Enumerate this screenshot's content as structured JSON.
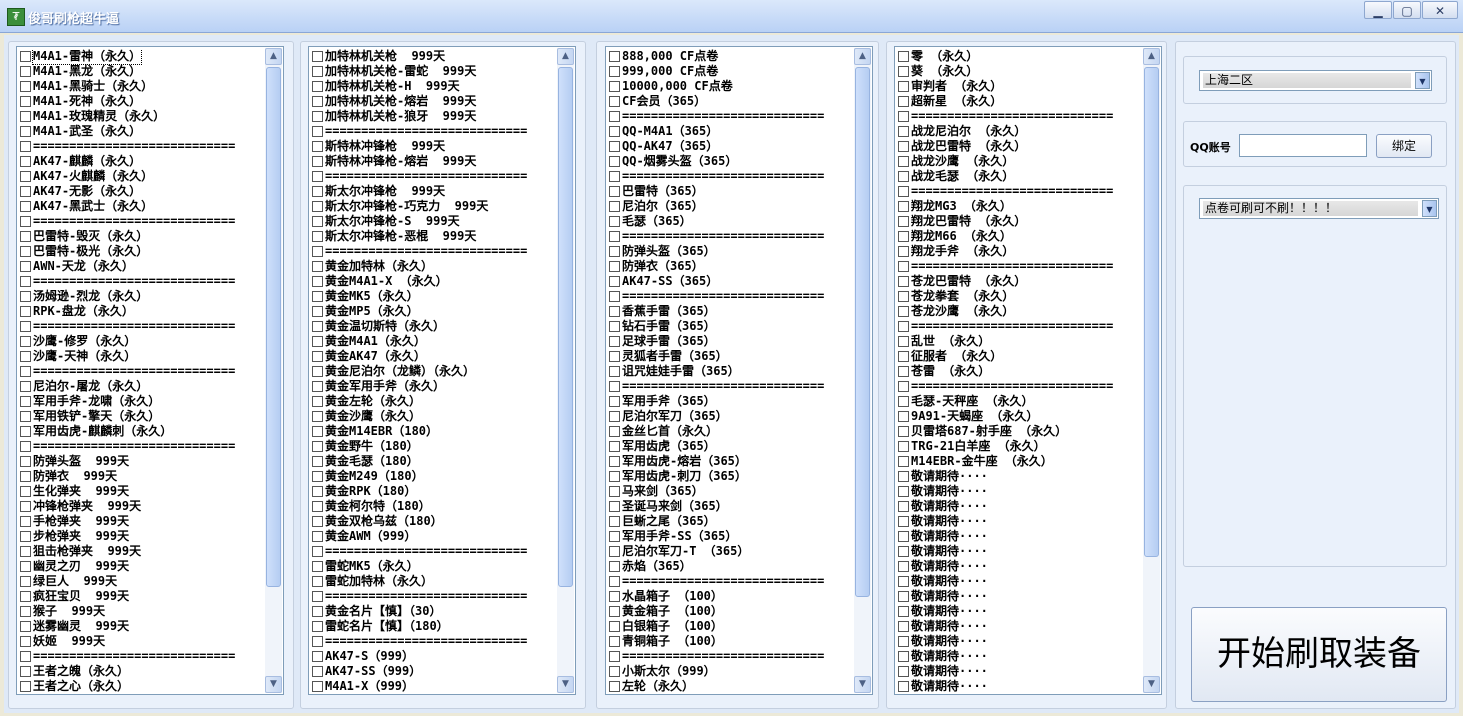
{
  "window": {
    "title": "俊哥刷枪超牛逼",
    "icon": "app-logo-icon",
    "controls": [
      "minimize-icon",
      "maximize-icon",
      "close-icon"
    ]
  },
  "lists": [
    [
      "M4A1-雷神（永久）",
      "M4A1-黑龙（永久）",
      "M4A1-黑骑士（永久）",
      "M4A1-死神（永久）",
      "M4A1-玫瑰精灵（永久）",
      "M4A1-武圣（永久）",
      "============================",
      "AK47-麒麟（永久）",
      "AK47-火麒麟（永久）",
      "AK47-无影（永久）",
      "AK47-黑武士（永久）",
      "============================",
      "巴雷特-毁灭（永久）",
      "巴雷特-极光（永久）",
      "AWN-天龙（永久）",
      "============================",
      "汤姆逊-烈龙（永久）",
      "RPK-盘龙（永久）",
      "============================",
      "沙鹰-修罗（永久）",
      "沙鹰-天神（永久）",
      "============================",
      "尼泊尔-屠龙（永久）",
      "军用手斧-龙啸（永久）",
      "军用铁铲-擎天（永久）",
      "军用齿虎-麒麟刺（永久）",
      "============================",
      "防弹头盔  999天",
      "防弹衣  999天",
      "生化弹夹  999天",
      "冲锋枪弹夹  999天",
      "手枪弹夹  999天",
      "步枪弹夹  999天",
      "狙击枪弹夹  999天",
      "幽灵之刃  999天",
      "绿巨人  999天",
      "疯狂宝贝  999天",
      "猴子  999天",
      "迷雾幽灵  999天",
      "妖姬  999天",
      "============================",
      "王者之魄（永久）",
      "王者之心（永久）"
    ],
    [
      "加特林机关枪  999天",
      "加特林机关枪-雷蛇  999天",
      "加特林机关枪-H  999天",
      "加特林机关枪-熔岩  999天",
      "加特林机关枪-狼牙  999天",
      "============================",
      "斯特林冲锋枪  999天",
      "斯特林冲锋枪-熔岩  999天",
      "============================",
      "斯太尔冲锋枪  999天",
      "斯太尔冲锋枪-巧克力  999天",
      "斯太尔冲锋枪-S  999天",
      "斯太尔冲锋枪-恶棍  999天",
      "============================",
      "黄金加特林（永久）",
      "黄金M4A1-X （永久）",
      "黄金MK5（永久）",
      "黄金MP5（永久）",
      "黄金温切斯特（永久）",
      "黄金M4A1（永久）",
      "黄金AK47（永久）",
      "黄金尼泊尔（龙鳞）（永久）",
      "黄金军用手斧（永久）",
      "黄金左轮（永久）",
      "黄金沙鹰（永久）",
      "黄金M14EBR（180）",
      "黄金野牛（180）",
      "黄金毛瑟（180）",
      "黄金M249（180）",
      "黄金RPK（180）",
      "黄金柯尔特（180）",
      "黄金双枪乌兹（180）",
      "黄金AWM（999）",
      "============================",
      "雷蛇MK5（永久）",
      "雷蛇加特林（永久）",
      "============================",
      "黄金名片【慎】（30）",
      "雷蛇名片【慎】（180）",
      "============================",
      "AK47-S（999）",
      "AK47-SS（999）",
      "M4A1-X（999）"
    ],
    [
      "888,000 CF点卷",
      "999,000 CF点卷",
      "10000,000 CF点卷",
      "CF会员（365）",
      "============================",
      "QQ-M4A1（365）",
      "QQ-AK47（365）",
      "QQ-烟雾头盔（365）",
      "============================",
      "巴雷特（365）",
      "尼泊尔（365）",
      "毛瑟（365）",
      "============================",
      "防弹头盔（365）",
      "防弹衣（365）",
      "AK47-SS（365）",
      "============================",
      "香蕉手雷（365）",
      "钻石手雷（365）",
      "足球手雷（365）",
      "灵狐者手雷（365）",
      "诅咒娃娃手雷（365）",
      "============================",
      "军用手斧（365）",
      "尼泊尔军刀（365）",
      "金丝匕首（永久）",
      "军用齿虎（365）",
      "军用齿虎-熔岩（365）",
      "军用齿虎-刺刀（365）",
      "马来剑（365）",
      "圣诞马来剑（365）",
      "巨蜥之尾（365）",
      "军用手斧-SS（365）",
      "尼泊尔军刀-T （365）",
      "赤焰（365）",
      "============================",
      "水晶箱子 （100）",
      "黄金箱子 （100）",
      "白银箱子 （100）",
      "青铜箱子 （100）",
      "============================",
      "小斯太尔（999）",
      "左轮（永久）"
    ],
    [
      "零 （永久）",
      "葵 （永久）",
      "审判者 （永久）",
      "超新星 （永久）",
      "============================",
      "战龙尼泊尔 （永久）",
      "战龙巴雷特 （永久）",
      "战龙沙鹰 （永久）",
      "战龙毛瑟 （永久）",
      "============================",
      "翔龙MG3 （永久）",
      "翔龙巴雷特 （永久）",
      "翔龙M66 （永久）",
      "翔龙手斧 （永久）",
      "============================",
      "苍龙巴雷特 （永久）",
      "苍龙拳套 （永久）",
      "苍龙沙鹰 （永久）",
      "============================",
      "乱世 （永久）",
      "征服者 （永久）",
      "苍雷 （永久）",
      "============================",
      "毛瑟-天秤座 （永久）",
      "9A91-天蝎座 （永久）",
      "贝雷塔687-射手座 （永久）",
      "TRG-21白羊座 （永久）",
      "M14EBR-金牛座 （永久）",
      "敬请期待····",
      "敬请期待····",
      "敬请期待····",
      "敬请期待····",
      "敬请期待····",
      "敬请期待····",
      "敬请期待····",
      "敬请期待····",
      "敬请期待····",
      "敬请期待····",
      "敬请期待····",
      "敬请期待····",
      "敬请期待····",
      "敬请期待····",
      "敬请期待····",
      "敬请期待····"
    ]
  ],
  "server_select": {
    "value": "上海二区"
  },
  "qq": {
    "label": "QQ账号",
    "value": "",
    "bind_button": "绑定"
  },
  "mode_select": {
    "value": "点卷可刷可不刷！！！！"
  },
  "start_button": "开始刷取装备",
  "colors": {
    "accent": "#316ac5",
    "panel_bg": "#eaf1fb"
  }
}
